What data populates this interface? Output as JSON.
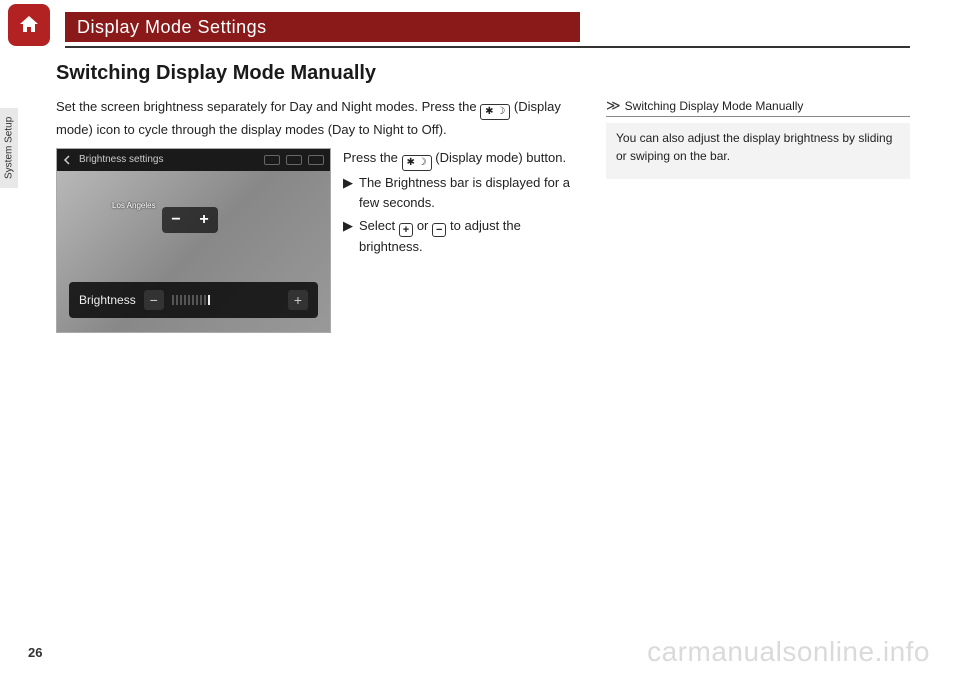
{
  "header": {
    "section_title": "Display Mode Settings"
  },
  "side_tab": "System Setup",
  "main": {
    "subtitle": "Switching Display Mode Manually",
    "intro_1": "Set the screen brightness separately for Day and Night modes. Press the ",
    "intro_2": " (Display mode) icon to cycle through the display modes (Day to Night to Off).",
    "step_press_1": "Press the ",
    "step_press_2": " (Display mode) button.",
    "bullet1": "The Brightness bar is displayed for a few seconds.",
    "bullet2_a": "Select ",
    "bullet2_b": " or ",
    "bullet2_c": " to adjust the brightness."
  },
  "figure": {
    "header_title": "Brightness settings",
    "map_label": "Los Angeles",
    "brightness_label": "Brightness",
    "minus": "−",
    "plus": "+"
  },
  "sidebar": {
    "header": "Switching Display Mode Manually",
    "body": "You can also adjust the display brightness by sliding or swiping on the bar."
  },
  "page_number": "26",
  "watermark": "carmanualsonline.info",
  "icons": {
    "display_mode_glyph": "✱ ☽",
    "plus": "+",
    "minus": "−",
    "triangle": "▶"
  }
}
